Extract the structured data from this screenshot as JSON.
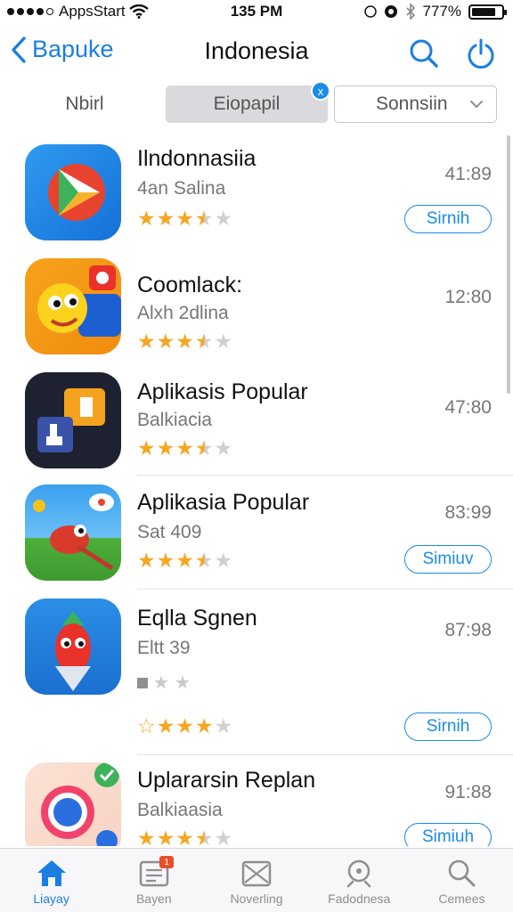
{
  "status_bar": {
    "carrier": "AppsStart",
    "time": "135 PM",
    "battery_text": "777%",
    "battery_level": 0.8
  },
  "nav": {
    "back_label": "Bapuke",
    "title": "Indonesia",
    "icons": [
      "chevron-left-icon",
      "search-icon",
      "refresh-icon"
    ]
  },
  "segments": {
    "items": [
      "Nbirl",
      "Eiopapil",
      "Sonnsiin"
    ],
    "selected_index": 1,
    "badge": "x"
  },
  "apps": [
    {
      "name": "Ilndonnasiia",
      "subtitle": "4an Salina",
      "price": "41:89",
      "rating": 3.5,
      "button": "Sirnih"
    },
    {
      "name": "Coomlack:",
      "subtitle": "Alxh 2dlina",
      "price": "12:80",
      "rating": 3.5,
      "button": ""
    },
    {
      "name": "Aplikasis Popular",
      "subtitle": "Balkiacia",
      "price": "47:80",
      "rating": 3.5,
      "button": ""
    },
    {
      "name": "Aplikasia Popular",
      "subtitle": "Sat 409",
      "price": "83:99",
      "rating": 3.5,
      "button": "Simiuv"
    },
    {
      "name": "Eqlla Sgnen",
      "subtitle": "Eltt 39",
      "price": "87:98",
      "rating": 4,
      "button": "Sirnih"
    },
    {
      "name": "Uplararsin Replan",
      "subtitle": "Balkiaasia",
      "price": "91:88",
      "rating": 3.5,
      "button": "Simiuh"
    }
  ],
  "tabs": [
    {
      "label": "Liayay",
      "icon": "home-icon",
      "active": true
    },
    {
      "label": "Bayen",
      "icon": "updates-icon",
      "active": false,
      "badge": "1"
    },
    {
      "label": "Noverling",
      "icon": "mail-icon",
      "active": false
    },
    {
      "label": "Fadodnesa",
      "icon": "location-search-icon",
      "active": false
    },
    {
      "label": "Cemees",
      "icon": "search-icon",
      "active": false
    }
  ],
  "colors": {
    "accent": "#1a7fe0",
    "star": "#f5a623",
    "segment_selected": "#d9d9de"
  }
}
